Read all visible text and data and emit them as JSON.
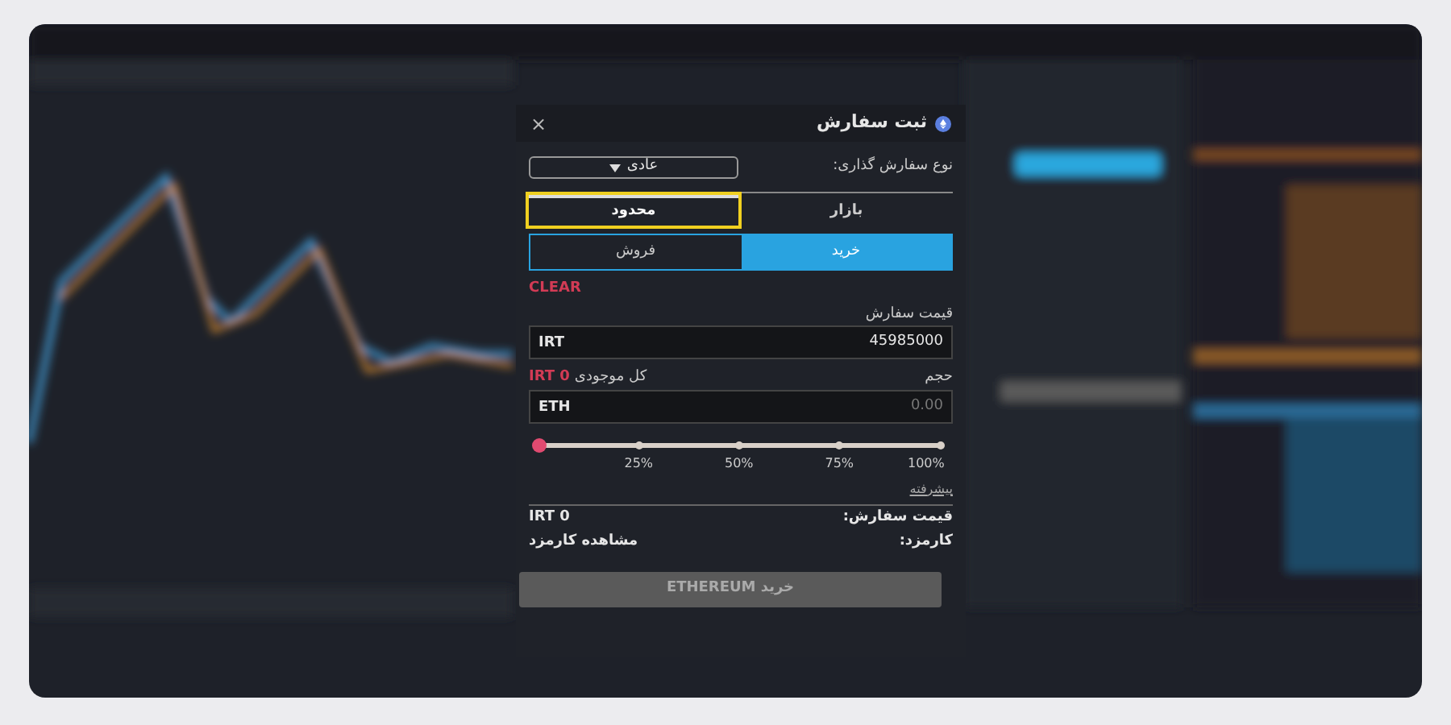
{
  "dialog": {
    "title": "ثبت سفارش",
    "close": "×",
    "order_type": {
      "label": "نوع سفارش گذاری:",
      "value": "عادی"
    },
    "tabs": [
      {
        "label": "بازار",
        "selected": false,
        "highlighted": false
      },
      {
        "label": "محدود",
        "selected": true,
        "highlighted": true
      }
    ],
    "sides": [
      {
        "label": "خرید",
        "selected": true
      },
      {
        "label": "فروش",
        "selected": false
      }
    ],
    "clear": "CLEAR",
    "price": {
      "label": "قیمت سفارش",
      "unit": "IRT",
      "value": "45985000"
    },
    "volume": {
      "label": "حجم",
      "balance_label": "کل موجودی",
      "balance": "IRT 0",
      "unit": "ETH",
      "placeholder": "0.00"
    },
    "slider": {
      "level": 0,
      "ticks": [
        "100%",
        "75%",
        "50%",
        "25%"
      ]
    },
    "advanced": "پیشرفته",
    "summary": [
      {
        "label": "قیمت سفارش:",
        "value": "IRT 0"
      },
      {
        "label": "کارمزد:",
        "value": "مشاهده کارمزد"
      }
    ],
    "submit": {
      "label": "خرید ETHEREUM",
      "disabled": true
    }
  }
}
